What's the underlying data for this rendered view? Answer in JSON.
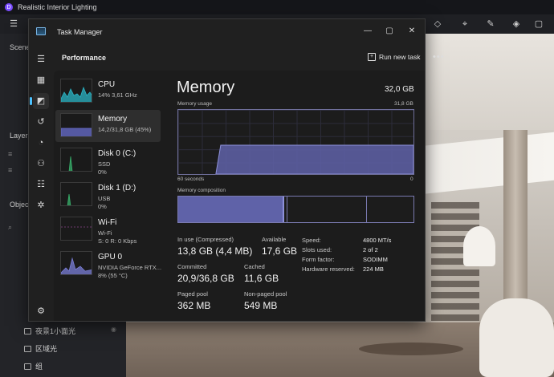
{
  "app": {
    "title": "Realistic Interior Lighting",
    "logo_glyph": "D"
  },
  "left_panel": {
    "scene_label": "Scene",
    "layers_label": "Layer",
    "objects_label": "Objec",
    "rows": [
      {
        "label": "夜景1小面光"
      },
      {
        "label": "区域光"
      },
      {
        "label": "组"
      }
    ]
  },
  "task_manager": {
    "title": "Task Manager",
    "section": "Performance",
    "run_new_task": "Run new task",
    "more": "•••",
    "nav_icons": [
      "hamburger-icon",
      "processes-icon",
      "performance-icon",
      "app-history-icon",
      "startup-icon",
      "users-icon",
      "details-icon",
      "services-icon",
      "settings-icon"
    ],
    "perf_items": [
      {
        "name": "CPU",
        "sub1": "14%  3,61 GHz",
        "sub2": "",
        "color": "#2bb5c6"
      },
      {
        "name": "Memory",
        "sub1": "14,2/31,8 GB (45%)",
        "sub2": "",
        "color": "#6a6fd0"
      },
      {
        "name": "Disk 0 (C:)",
        "sub1": "SSD",
        "sub2": "0%",
        "color": "#38b06b"
      },
      {
        "name": "Disk 1 (D:)",
        "sub1": "USB",
        "sub2": "0%",
        "color": "#38b06b"
      },
      {
        "name": "Wi-Fi",
        "sub1": "Wi-Fi",
        "sub2": "S: 0  R: 0 Kbps",
        "color": "#c05dc0"
      },
      {
        "name": "GPU 0",
        "sub1": "NVIDIA GeForce RTX...",
        "sub2": "8%  (55 °C)",
        "color": "#7b7fd8"
      }
    ],
    "memory": {
      "title": "Memory",
      "total": "32,0 GB",
      "usage_label": "Memory usage",
      "usage_max": "31,8 GB",
      "time_left": "60 seconds",
      "time_right": "0",
      "composition_label": "Memory composition",
      "usage_fraction": 0.45,
      "composition": {
        "in_use": 0.45,
        "modified_end": 0.46,
        "standby_end": 0.8
      },
      "stats": [
        {
          "label": "In use (Compressed)",
          "value": "13,8 GB (4,4 MB)"
        },
        {
          "label": "Available",
          "value": "17,6 GB"
        },
        {
          "label": "Committed",
          "value": "20,9/36,8 GB"
        },
        {
          "label": "Cached",
          "value": "11,6 GB"
        },
        {
          "label": "Paged pool",
          "value": "362 MB"
        },
        {
          "label": "Non-paged pool",
          "value": "549 MB"
        }
      ],
      "specs": [
        {
          "label": "Speed:",
          "value": "4800 MT/s"
        },
        {
          "label": "Slots used:",
          "value": "2 of 2"
        },
        {
          "label": "Form factor:",
          "value": "SODIMM"
        },
        {
          "label": "Hardware reserved:",
          "value": "224 MB"
        }
      ]
    }
  }
}
